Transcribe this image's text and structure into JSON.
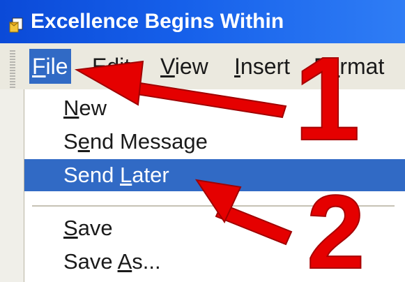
{
  "window": {
    "title": "Excellence Begins Within"
  },
  "menubar": {
    "items": [
      {
        "label": "File",
        "mnemonic": "F",
        "rest": "ile",
        "active": true
      },
      {
        "label": "Edit",
        "mnemonic": "E",
        "rest": "dit",
        "active": false
      },
      {
        "label": "View",
        "mnemonic": "V",
        "rest": "iew",
        "active": false
      },
      {
        "label": "Insert",
        "mnemonic": "I",
        "rest": "nsert",
        "active": false
      },
      {
        "label": "Format",
        "prefix": "F",
        "mnemonic": "o",
        "rest": "rmat",
        "active": false
      }
    ]
  },
  "file_menu": {
    "items": [
      {
        "label": "New",
        "pre": "",
        "mnemonic": "N",
        "post": "ew",
        "highlighted": false
      },
      {
        "label": "Send Message",
        "pre": "S",
        "mnemonic": "e",
        "post": "nd Message",
        "highlighted": false
      },
      {
        "label": "Send Later",
        "pre": "Send ",
        "mnemonic": "L",
        "post": "ater",
        "highlighted": true
      },
      {
        "label": "Save",
        "pre": "",
        "mnemonic": "S",
        "post": "ave",
        "highlighted": false
      },
      {
        "label": "Save As...",
        "pre": "Save ",
        "mnemonic": "A",
        "post": "s...",
        "highlighted": false
      }
    ]
  },
  "annotations": {
    "step1": "1",
    "step2": "2",
    "arrow_color": "#e50000"
  }
}
